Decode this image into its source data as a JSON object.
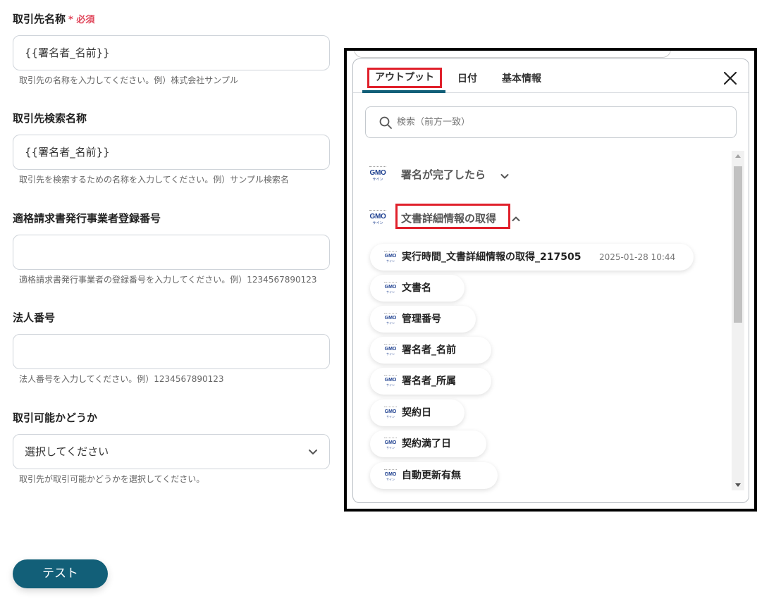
{
  "form": {
    "fields": [
      {
        "label": "取引先名称",
        "required_label": "必須",
        "value": "{{署名者_名前}}",
        "help": "取引先の名称を入力してください。例）株式会社サンプル"
      },
      {
        "label": "取引先検索名称",
        "value": "{{署名者_名前}}",
        "help": "取引先を検索するための名称を入力してください。例）サンプル検索名"
      },
      {
        "label": "適格請求書発行事業者登録番号",
        "value": "",
        "help": "適格請求書発行事業者の登録番号を入力してください。例）1234567890123"
      },
      {
        "label": "法人番号",
        "value": "",
        "help": "法人番号を入力してください。例）1234567890123"
      },
      {
        "label": "取引可能かどうか",
        "selected": "選択してください",
        "help": "取引先が取引可能かどうかを選択してください。"
      }
    ],
    "required_asterisk": "*",
    "test_button": "テスト"
  },
  "picker": {
    "tabs": {
      "output": "アウトプット",
      "date": "日付",
      "basic": "基本情報"
    },
    "search_placeholder": "検索（前方一致）",
    "logo": {
      "mark": "GMO",
      "sub": "サイン"
    },
    "sections": [
      {
        "title": "署名が完了したら",
        "expanded": false
      },
      {
        "title": "文書詳細情報の取得",
        "expanded": true
      }
    ],
    "items": [
      {
        "label": "実行時間_文書詳細情報の取得_217505",
        "value": "2025-01-28 10:44"
      },
      {
        "label": "文書名"
      },
      {
        "label": "管理番号"
      },
      {
        "label": "署名者_名前"
      },
      {
        "label": "署名者_所属"
      },
      {
        "label": "契約日"
      },
      {
        "label": "契約満了日"
      },
      {
        "label": "自動更新有無"
      }
    ]
  },
  "colors": {
    "accent": "#125f78",
    "highlight": "#e0202b",
    "required": "#e0465a"
  }
}
